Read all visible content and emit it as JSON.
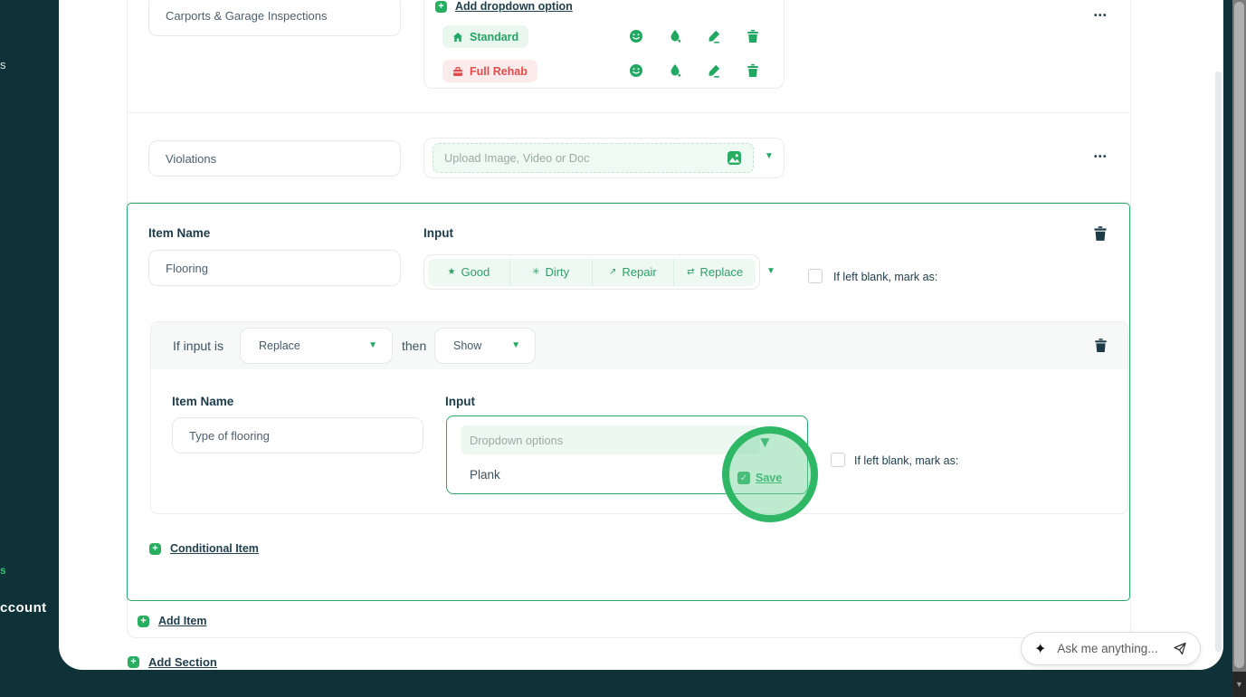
{
  "colors": {
    "accent_green": "#23a863",
    "accent_red": "#e14b4b",
    "dark_teal_bg": "#0f3238",
    "label_navy": "#1c3b4a"
  },
  "sidebar": {
    "fragment_top": "s",
    "fragment_green": "s",
    "fragment_account": "ccount"
  },
  "rows": {
    "carports": {
      "name_value": "Carports & Garage Inspections",
      "add_dropdown_link": "Add dropdown option",
      "options": [
        {
          "label": "Standard",
          "color": "green",
          "icon": "house-icon"
        },
        {
          "label": "Full Rehab",
          "color": "red",
          "icon": "toolbox-icon"
        }
      ],
      "more_menu": "•••"
    },
    "violations": {
      "name_value": "Violations",
      "upload_placeholder": "Upload Image, Video or Doc",
      "more_menu": "•••"
    }
  },
  "item": {
    "item_name_label": "Item Name",
    "item_name_value": "Flooring",
    "input_label": "Input",
    "segments": [
      {
        "glyph": "★",
        "label": "Good"
      },
      {
        "glyph": "✳",
        "label": "Dirty"
      },
      {
        "glyph": "↗",
        "label": "Repair"
      },
      {
        "glyph": "⇄",
        "label": "Replace"
      }
    ],
    "blank_label": "If left blank, mark as:",
    "conditional": {
      "prefix": "If input is",
      "condition_value": "Replace",
      "middle": "then",
      "action_value": "Show",
      "item_name_label": "Item Name",
      "item_name_value": "Type of flooring",
      "input_label": "Input",
      "dropdown_placeholder": "Dropdown options",
      "option_value": "Plank",
      "save_label": "Save",
      "blank_label": "If left blank, mark as:"
    },
    "conditional_item_link": "Conditional Item"
  },
  "add_item_link": "Add Item",
  "add_section_link": "Add Section",
  "chat": {
    "placeholder": "Ask me anything..."
  },
  "glyphs": {
    "caret": "▼",
    "sparkle": "✦",
    "scroll_down": "▼",
    "plus": "+",
    "check": "✓"
  }
}
